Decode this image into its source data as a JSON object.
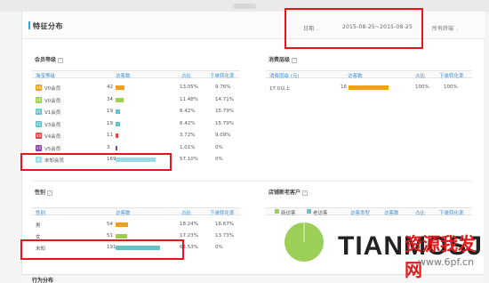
{
  "header": {
    "title": "特征分布",
    "date_label": "日期",
    "date_range": "2015-08-25~2015-08-25",
    "terminal": "所有终端"
  },
  "member_level": {
    "title": "会员等级",
    "columns": [
      "淘宝等级",
      "访客数",
      "占比",
      "下单转化率"
    ],
    "rows": [
      {
        "badge": "V0",
        "label": "V0会员",
        "visitors": "42",
        "share": "13.05%",
        "conversion": "9.76%",
        "color": "#f0a020"
      },
      {
        "badge": "V0",
        "label": "V0会员",
        "visitors": "34",
        "share": "11.48%",
        "conversion": "14.71%",
        "color": "#9ccf58"
      },
      {
        "badge": "V1",
        "label": "V1会员",
        "visitors": "19",
        "share": "6.42%",
        "conversion": "15.79%",
        "color": "#66c2c8"
      },
      {
        "badge": "V3",
        "label": "V3会员",
        "visitors": "19",
        "share": "6.42%",
        "conversion": "15.79%",
        "color": "#66c2c8"
      },
      {
        "badge": "V4",
        "label": "V4会员",
        "visitors": "11",
        "share": "3.72%",
        "conversion": "9.09%",
        "color": "#e04848"
      },
      {
        "badge": "V5",
        "label": "V5会员",
        "visitors": "3",
        "share": "1.01%",
        "conversion": "0%",
        "color": "#8a3fa6"
      },
      {
        "badge": "未",
        "label": "未知会员",
        "visitors": "169",
        "share": "57.10%",
        "conversion": "0%",
        "color": "#9adbe6"
      }
    ]
  },
  "consumption": {
    "title": "消费层级",
    "columns": [
      "消费层级 (元)",
      "访客数",
      "占比",
      "下单转化率"
    ],
    "rows": [
      {
        "label": "17.0以上",
        "visitors": "16",
        "share": "100%",
        "conversion": "100%"
      }
    ]
  },
  "gender": {
    "title": "性别",
    "columns": [
      "性别",
      "访客数",
      "占比",
      "下单转化率"
    ],
    "rows": [
      {
        "label": "男",
        "visitors": "54",
        "share": "18.24%",
        "conversion": "16.67%"
      },
      {
        "label": "女",
        "visitors": "51",
        "share": "17.23%",
        "conversion": "13.73%"
      },
      {
        "label": "未知",
        "visitors": "191",
        "share": "64.53%",
        "conversion": "0%"
      }
    ]
  },
  "new_old": {
    "title": "店铺新老客户",
    "legend": [
      "新访客",
      "老访客"
    ],
    "columns": [
      "访客类型",
      "访客数",
      "占比",
      "下单转化率"
    ]
  },
  "footer": {
    "next_section": "行为分布"
  },
  "watermark": {
    "brand": "TIANMOSJ",
    "cn": "资源我发网",
    "site": "www.6pf.cn"
  },
  "colors": {
    "accent_blue": "#3aa3e3",
    "red_box": "#e8141c",
    "bar_orange": "#f0a020",
    "bar_teal": "#66c2c8",
    "bar_green": "#9ccf58"
  }
}
